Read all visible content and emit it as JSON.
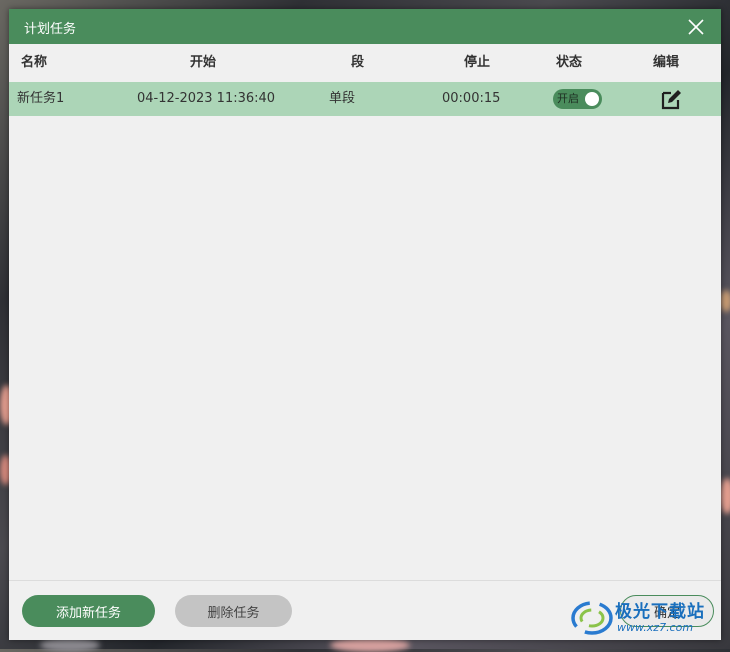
{
  "dialog": {
    "title": "计划任务",
    "colors": {
      "accent": "#4a8c5c",
      "row_highlight": "#acd5b7",
      "background": "#f0f0f0"
    }
  },
  "table": {
    "columns": [
      "名称",
      "开始",
      "段",
      "停止",
      "状态",
      "编辑"
    ],
    "rows": [
      {
        "name": "新任务1",
        "start": "04-12-2023 11:36:40",
        "segment": "单段",
        "stop": "00:00:15",
        "status_label": "开启",
        "status_on": true
      }
    ]
  },
  "footer": {
    "add_label": "添加新任务",
    "delete_label": "删除任务",
    "ok_label": "确定"
  },
  "watermark": {
    "brand": "极光下载站",
    "url": "www.xz7.com"
  },
  "icons": {
    "close": "close-icon",
    "edit": "edit-icon",
    "watermark_logo": "swirl-logo-icon"
  }
}
